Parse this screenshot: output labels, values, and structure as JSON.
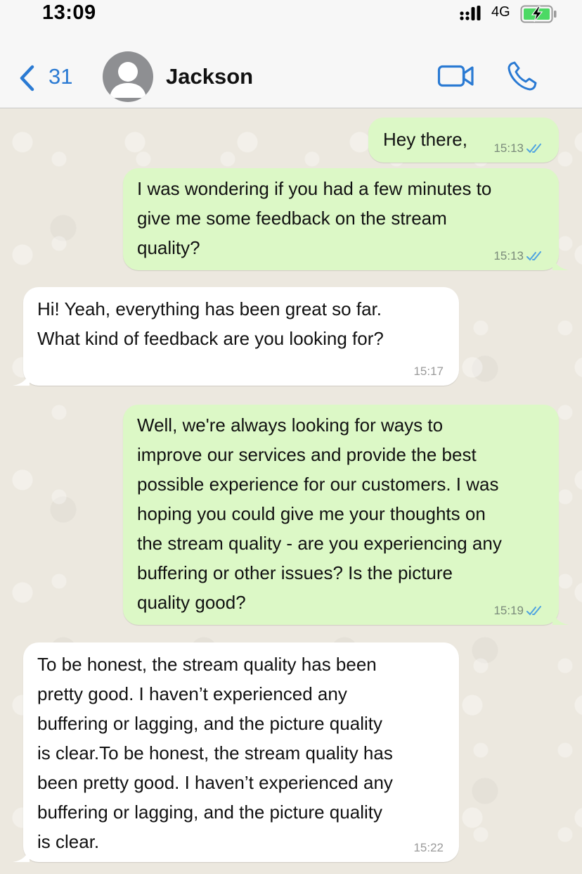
{
  "status_bar": {
    "time": "13:09",
    "network": "4G"
  },
  "header": {
    "back_count": "31",
    "contact_name": "Jackson"
  },
  "colors": {
    "accent": "#2a7ad3",
    "outgoing_bubble": "#dcf8c6",
    "incoming_bubble": "#ffffff",
    "read_tick": "#4fa3e0"
  },
  "messages": [
    {
      "direction": "outgoing",
      "text": "Hey there,",
      "time": "15:13",
      "status": "read"
    },
    {
      "direction": "outgoing",
      "text": "I was wondering if you had a few minutes to\ngive me some feedback on the stream\nquality?",
      "time": "15:13",
      "status": "read"
    },
    {
      "direction": "incoming",
      "text": "Hi! Yeah, everything has been great so far.\nWhat kind of feedback are you looking for?",
      "time": "15:17"
    },
    {
      "direction": "outgoing",
      "text": "Well, we're always looking for ways to\nimprove our services and provide the best\npossible experience for our customers. I was\nhoping you could give me your thoughts on\nthe stream quality - are you experiencing any\nbuffering or other issues? Is the picture\nquality good?",
      "time": "15:19",
      "status": "read"
    },
    {
      "direction": "incoming",
      "text": "To be honest, the stream quality has been\npretty good. I haven’t experienced any\nbuffering or lagging, and the picture quality\nis clear.To be honest, the stream quality has\nbeen pretty good. I haven’t experienced any\nbuffering or lagging, and the picture quality\nis clear.",
      "time": "15:22"
    }
  ]
}
